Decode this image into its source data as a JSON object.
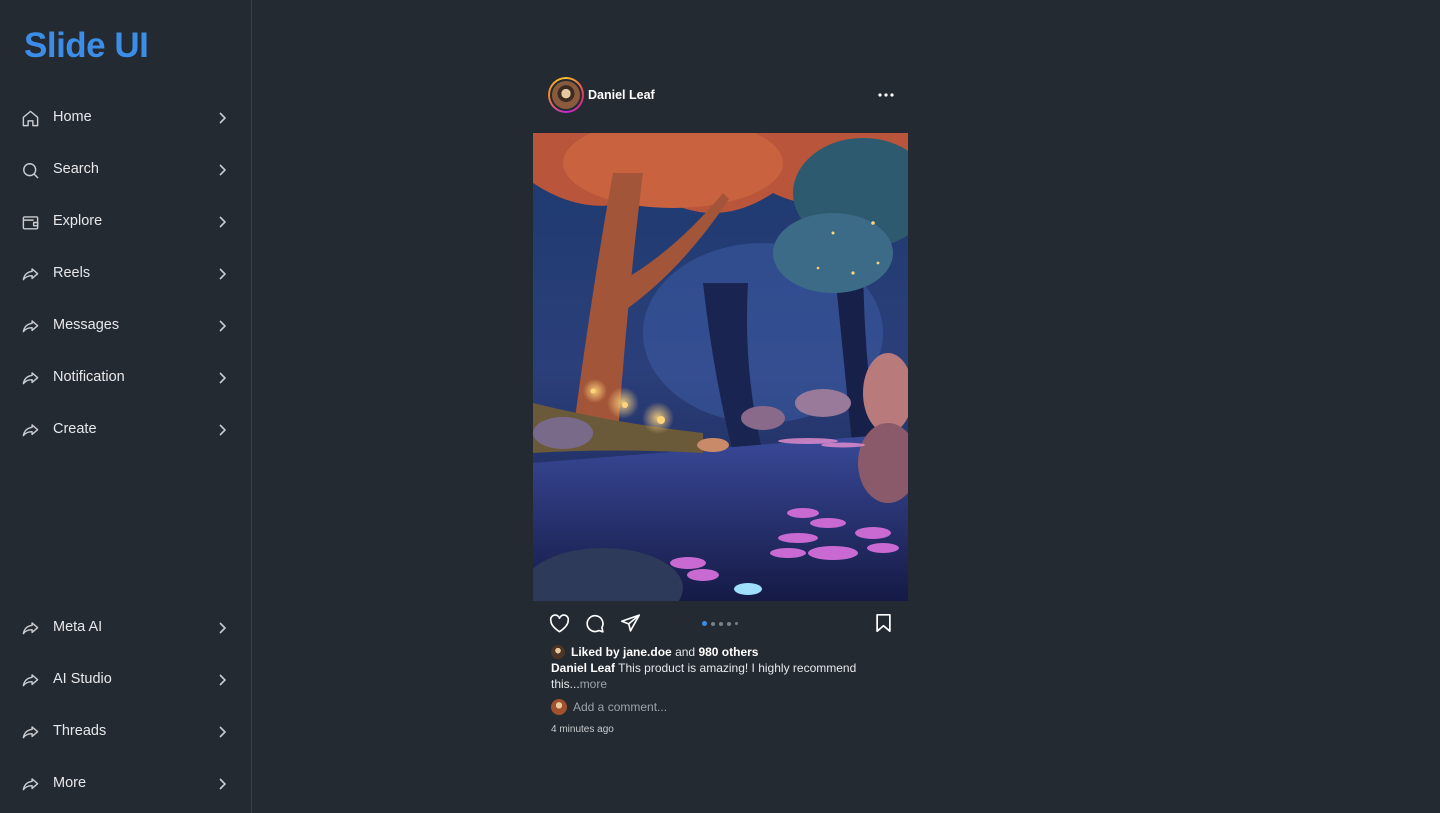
{
  "app": {
    "logo": "Slide UI",
    "accent": "#3b8de8"
  },
  "sidebar": {
    "items": [
      {
        "label": "Home",
        "icon": "home-icon"
      },
      {
        "label": "Search",
        "icon": "search-icon"
      },
      {
        "label": "Explore",
        "icon": "explore-icon"
      },
      {
        "label": "Reels",
        "icon": "share-arrow-icon"
      },
      {
        "label": "Messages",
        "icon": "share-arrow-icon"
      },
      {
        "label": "Notification",
        "icon": "share-arrow-icon"
      },
      {
        "label": "Create",
        "icon": "share-arrow-icon"
      }
    ],
    "bottom_items": [
      {
        "label": "Meta AI",
        "icon": "share-arrow-icon"
      },
      {
        "label": "AI Studio",
        "icon": "share-arrow-icon"
      },
      {
        "label": "Threads",
        "icon": "share-arrow-icon"
      },
      {
        "label": "More",
        "icon": "share-arrow-icon"
      }
    ]
  },
  "post": {
    "username": "Daniel Leaf",
    "image_description_icon": "enchanted-forest-image",
    "carousel": {
      "count": 5,
      "active": 1
    },
    "likes": {
      "prefix": "Liked by",
      "user": "jane.doe",
      "joiner": "and",
      "others": "980 others"
    },
    "caption": {
      "author": "Daniel Leaf",
      "text": "This product is amazing! I highly recommend this...",
      "more": "more"
    },
    "comment_placeholder": "Add a comment...",
    "timestamp": "4 minutes ago"
  }
}
